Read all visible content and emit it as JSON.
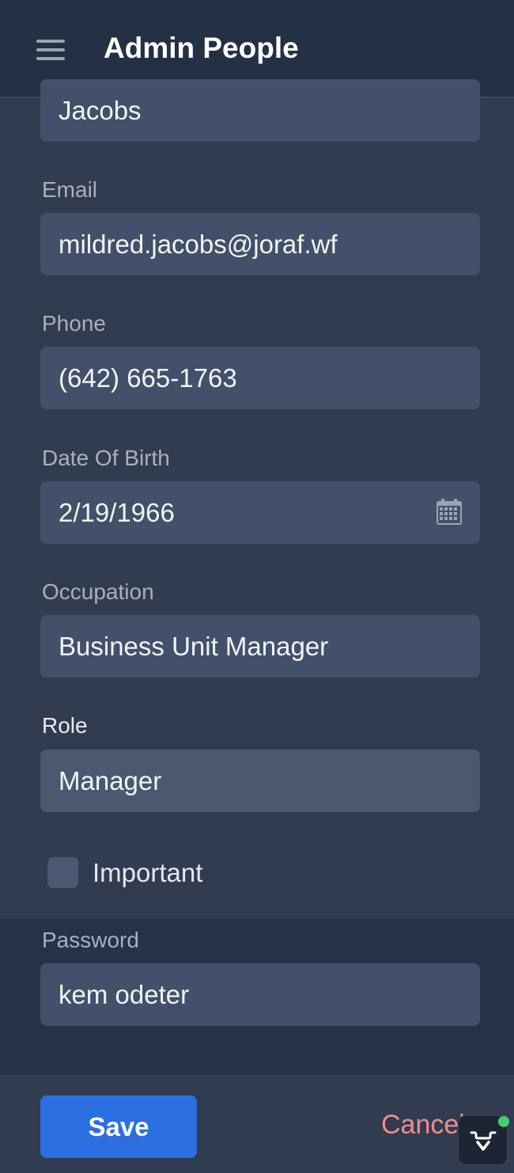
{
  "header": {
    "title": "Admin People",
    "menu_icon": "hamburger-menu-icon"
  },
  "form": {
    "last_name_value": "Jacobs",
    "email_label": "Email",
    "email_value": "mildred.jacobs@joraf.wf",
    "phone_label": "Phone",
    "phone_value": "(642) 665-1763",
    "dob_label": "Date Of Birth",
    "dob_value": "2/19/1966",
    "occupation_label": "Occupation",
    "occupation_value": "Business Unit Manager",
    "role_label": "Role",
    "role_value": "Manager",
    "important_label": "Important",
    "important_checked": false,
    "password_label": "Password",
    "password_value": "kem odeter"
  },
  "footer": {
    "save_label": "Save",
    "cancel_label": "Cancel"
  },
  "colors": {
    "primary": "#2c6fe0",
    "danger": "#f08c8c",
    "status": "#3fcf6e"
  }
}
